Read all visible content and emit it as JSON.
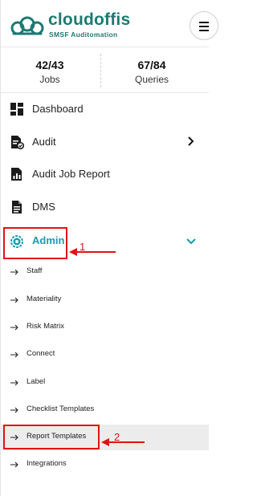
{
  "brand": {
    "name": "cloudoffis",
    "tagline": "SMSF Auditomation",
    "color": "#1d7a73"
  },
  "stats": [
    {
      "value": "42/43",
      "label": "Jobs"
    },
    {
      "value": "67/84",
      "label": "Queries"
    }
  ],
  "nav": {
    "items": [
      {
        "label": "Dashboard",
        "icon": "dashboard-icon"
      },
      {
        "label": "Audit",
        "icon": "audit-icon",
        "has_chevron": true
      },
      {
        "label": "Audit Job Report",
        "icon": "report-icon"
      },
      {
        "label": "DMS",
        "icon": "document-icon"
      }
    ],
    "admin": {
      "label": "Admin",
      "icon": "gear-icon",
      "expanded": true,
      "accent": "#1a9bb0"
    },
    "sub_items": [
      {
        "label": "Staff"
      },
      {
        "label": "Materiality"
      },
      {
        "label": "Risk Matrix"
      },
      {
        "label": "Connect"
      },
      {
        "label": "Label"
      },
      {
        "label": "Checklist Templates"
      },
      {
        "label": "Report Templates",
        "active": true
      },
      {
        "label": "Integrations"
      }
    ]
  },
  "annotations": [
    {
      "number": "1",
      "target": "Admin"
    },
    {
      "number": "2",
      "target": "Report Templates"
    }
  ],
  "annotation_color": "#e01212"
}
